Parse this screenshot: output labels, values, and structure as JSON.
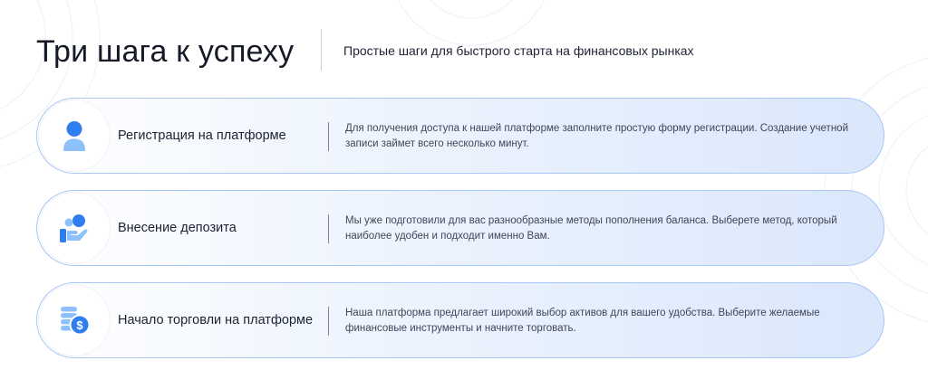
{
  "header": {
    "title": "Три шага к успеху",
    "subtitle": "Простые шаги для быстрого старта на финансовых рынках"
  },
  "colors": {
    "accent": "#2f7ef0",
    "accent_light": "#8ec1fb",
    "card_border": "#a9c7f4"
  },
  "steps": [
    {
      "icon": "user-icon",
      "title": "Регистрация на платформе",
      "description": "Для получения доступа к нашей платформе заполните простую форму регистрации. Создание учетной записи займет всего несколько минут."
    },
    {
      "icon": "deposit-icon",
      "title": "Внесение депозита",
      "description": "Мы уже подготовили для вас разнообразные методы пополнения баланса. Выберете метод, который наиболее удобен и подходит именно Вам."
    },
    {
      "icon": "trading-coins-icon",
      "title": "Начало торговли на платформе",
      "description": "Наша платформа предлагает широкий выбор активов для вашего удобства. Выберите желаемые финансовые инструменты и начните торговать."
    }
  ]
}
